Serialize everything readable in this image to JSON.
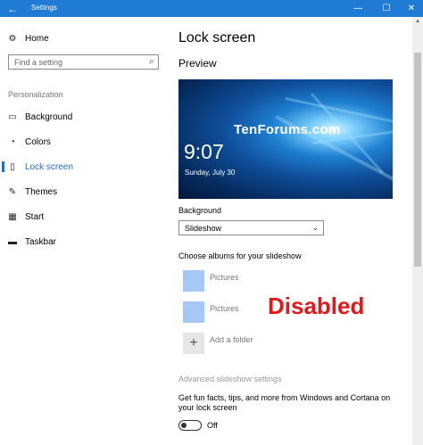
{
  "window": {
    "title": "Settings",
    "back_icon": "←",
    "min_icon": "—",
    "max_icon": "☐",
    "close_icon": "✕"
  },
  "sidebar": {
    "home": {
      "icon": "⚙",
      "label": "Home"
    },
    "search_placeholder": "Find a setting",
    "search_icon": "⌕",
    "section": "Personalization",
    "items": [
      {
        "icon": "▭",
        "label": "Background"
      },
      {
        "icon": "◔",
        "label": "Colors"
      },
      {
        "icon": "▯",
        "label": "Lock screen"
      },
      {
        "icon": "✎",
        "label": "Themes"
      },
      {
        "icon": "▦",
        "label": "Start"
      },
      {
        "icon": "▬",
        "label": "Taskbar"
      }
    ],
    "active_index": 2
  },
  "main": {
    "title": "Lock screen",
    "preview_label": "Preview",
    "preview": {
      "brand": "TenForums.com",
      "time": "9:07",
      "date": "Sunday, July 30"
    },
    "background_label": "Background",
    "background_value": "Slideshow",
    "albums_label": "Choose albums for your slideshow",
    "albums": [
      "Pictures",
      "Pictures"
    ],
    "add_folder": {
      "icon": "+",
      "label": "Add a folder"
    },
    "disabled_stamp": "Disabled",
    "advanced_label": "Advanced slideshow settings",
    "fun_facts": "Get fun facts, tips, and more from Windows and Cortana on your lock screen",
    "toggle_state": "Off"
  },
  "colors": {
    "accent": "#1f6fd1",
    "titlebar": "#1f7bd3",
    "stamp": "#e3181b"
  }
}
